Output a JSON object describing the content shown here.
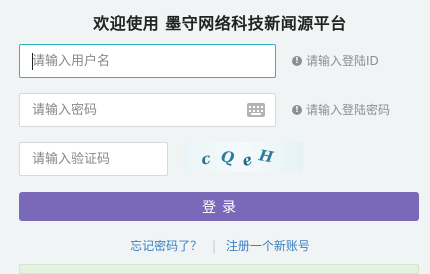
{
  "title": "欢迎使用 墨守网络科技新闻源平台",
  "username": {
    "placeholder": "请输入用户名",
    "hint": "请输入登陆ID"
  },
  "password": {
    "placeholder": "请输入密码",
    "hint": "请输入登陆密码",
    "keyboard_icon": "keyboard-icon"
  },
  "captcha": {
    "placeholder": "请输入验证码",
    "chars": [
      "c",
      "Q",
      "e",
      "H"
    ],
    "char_colors": [
      "#2d6f8a",
      "#2a7aa0",
      "#1f6a8a",
      "#2b7c9c"
    ]
  },
  "login_label": "登录",
  "links": {
    "forgot": "忘记密码了？",
    "register": "注册一个新账号"
  },
  "colors": {
    "accent": "#7a68b8",
    "focus": "#2fb1c5",
    "link": "#3d7fbf"
  }
}
